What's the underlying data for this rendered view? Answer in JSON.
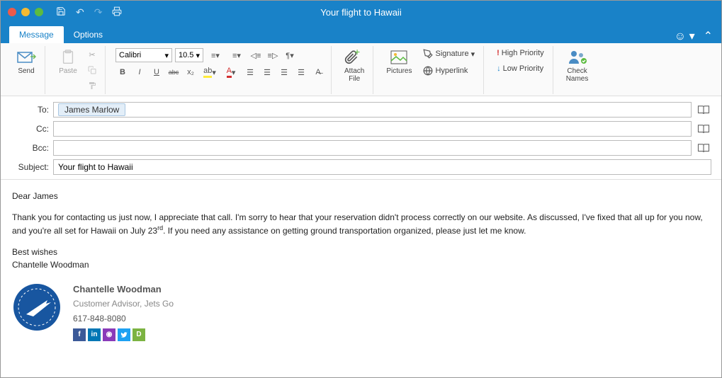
{
  "titlebar": {
    "title": "Your flight to Hawaii"
  },
  "tabs": {
    "message": "Message",
    "options": "Options"
  },
  "ribbon": {
    "send": "Send",
    "paste": "Paste",
    "font": "Calibri",
    "size": "10.5",
    "attach": "Attach\nFile",
    "pictures": "Pictures",
    "signature": "Signature",
    "hyperlink": "Hyperlink",
    "high_priority": "High Priority",
    "low_priority": "Low Priority",
    "check_names": "Check\nNames"
  },
  "headers": {
    "to_label": "To:",
    "to_chip": "James Marlow",
    "cc_label": "Cc:",
    "bcc_label": "Bcc:",
    "subject_label": "Subject:",
    "subject_value": "Your flight to Hawaii"
  },
  "body": {
    "greeting": "Dear James",
    "p1a": "Thank you for contacting us just now, I appreciate that call. I'm sorry to hear that your reservation didn't process correctly on our website. As discussed, I've fixed that all up for you now, and you're all set for Hawaii on July 23",
    "p1sup": "rd",
    "p1b": ". If you need any assistance on getting ground transportation organized, please just let me know.",
    "closing": "Best wishes",
    "sender": "Chantelle Woodman"
  },
  "signature": {
    "name": "Chantelle Woodman",
    "role": "Customer Advisor, Jets Go",
    "phone": "617-848-8080"
  }
}
